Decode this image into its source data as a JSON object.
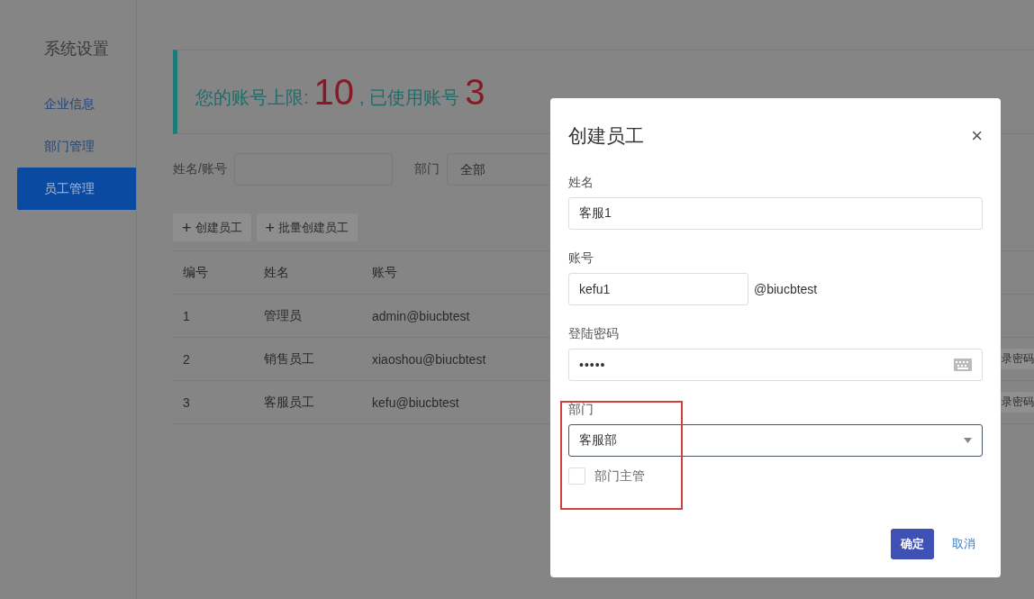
{
  "sidebar": {
    "title": "系统设置",
    "items": [
      {
        "label": "企业信息",
        "selected": false
      },
      {
        "label": "部门管理",
        "selected": false
      },
      {
        "label": "员工管理",
        "selected": true
      }
    ]
  },
  "banner": {
    "limit_label": "您的账号上限:",
    "limit_value": "10",
    "used_label": ", 已使用账号",
    "used_value": "3"
  },
  "filters": {
    "name_label": "姓名/账号",
    "dept_label": "部门",
    "dept_value": "全部"
  },
  "toolbar": [
    {
      "icon": "+",
      "label": "创建员工"
    },
    {
      "icon": "+",
      "label": "批量创建员工"
    }
  ],
  "table": {
    "columns": [
      "编号",
      "姓名",
      "账号"
    ],
    "rows": [
      {
        "cells": [
          "1",
          "管理员",
          "admin@biucbtest"
        ]
      },
      {
        "cells": [
          "2",
          "销售员工",
          "xiaoshou@biucbtest"
        ],
        "action": "录密码"
      },
      {
        "cells": [
          "3",
          "客服员工",
          "kefu@biucbtest"
        ],
        "action": "录密码"
      }
    ]
  },
  "modal": {
    "title": "创建员工",
    "close": "×",
    "fields": [
      {
        "kind": "text",
        "label": "姓名",
        "value": "客服1"
      },
      {
        "kind": "account",
        "label": "账号",
        "value": "kefu1",
        "suffix": "@biucbtest"
      },
      {
        "kind": "password",
        "label": "登陆密码",
        "value": "•••••"
      },
      {
        "kind": "select",
        "label": "部门",
        "value": "客服部"
      }
    ],
    "checkbox": {
      "label": "部门主管",
      "checked": false
    },
    "buttons": [
      {
        "kind": "primary",
        "label": "确定"
      },
      {
        "kind": "link",
        "label": "取消"
      }
    ]
  }
}
